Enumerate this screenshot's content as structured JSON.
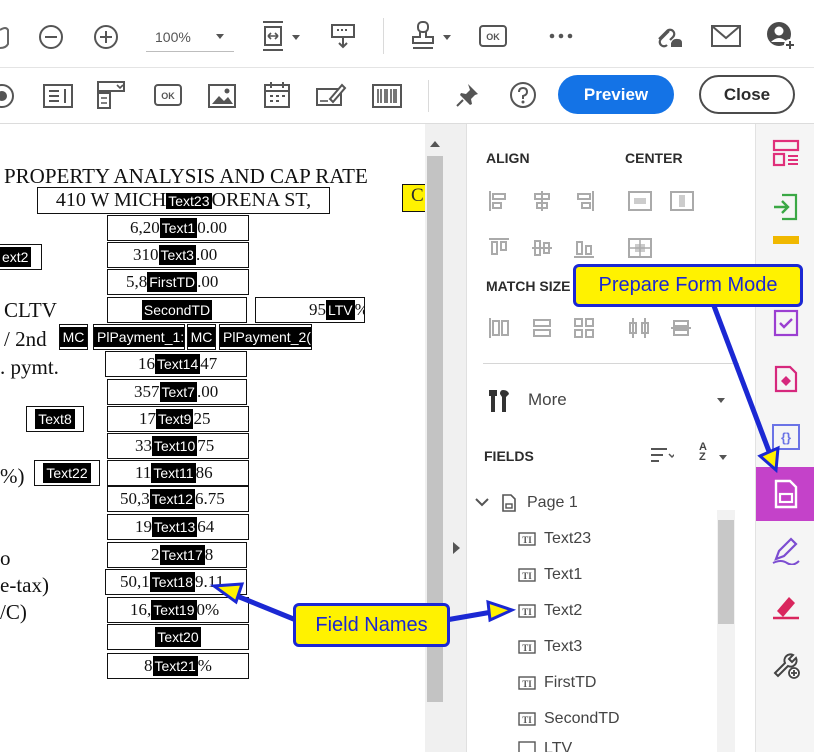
{
  "toolbar": {
    "zoom_value": "100%",
    "preview_label": "Preview",
    "close_label": "Close",
    "ok_label": "OK"
  },
  "document": {
    "title_line": "PROPERTY ANALYSIS AND CAP RATE",
    "address_left": "410 W MICH",
    "address_right": "ORENA ST,",
    "address_field": "Text23",
    "yellow_cell": "C",
    "labels": {
      "cltv": "CLTV",
      "second": "/ 2nd",
      "pymt": ". pymt.",
      "pct": "%)",
      "o": "o",
      "tax": "e-tax)",
      "c": "/C)"
    },
    "side_fields": {
      "text2": "ext2",
      "text8": "Text8",
      "text22": "Text22",
      "mc1": "MC",
      "mc2": "MC",
      "plpayment1": "PlPayment_1:",
      "plpayment2": "PlPayment_2("
    },
    "fields": [
      {
        "left_val": "6,20",
        "name": "Text1",
        "right_val": "0.00"
      },
      {
        "left_val": "310",
        "name": "Text3",
        "right_val": ".00"
      },
      {
        "left_val": "5,8",
        "name": "FirstTD",
        "right_val": ".00"
      },
      {
        "left_val": "",
        "name": "SecondTD",
        "right_val": ""
      },
      {
        "left_val": "16",
        "name": "Text14",
        "right_val": "47"
      },
      {
        "left_val": "357",
        "name": "Text7",
        "right_val": ".00"
      },
      {
        "left_val": "17",
        "name": "Text9",
        "right_val": "25"
      },
      {
        "left_val": "33",
        "name": "Text10",
        "right_val": "75"
      },
      {
        "left_val": "11",
        "name": "Text11",
        "right_val": "86"
      },
      {
        "left_val": "50,3",
        "name": "Text12",
        "right_val": "6.75"
      },
      {
        "left_val": "19",
        "name": "Text13",
        "right_val": "64"
      },
      {
        "left_val": "2",
        "name": "Text17",
        "right_val": "8"
      },
      {
        "left_val": "50,1",
        "name": "Text18",
        "right_val": "9.11"
      },
      {
        "left_val": "16,",
        "name": "Text19",
        "right_val": "0%"
      },
      {
        "left_val": "",
        "name": "Text20",
        "right_val": ""
      },
      {
        "left_val": "8",
        "name": "Text21",
        "right_val": "%"
      }
    ],
    "ltv_field": {
      "left_val": "95",
      "name": "LTV",
      "right_val": "%"
    }
  },
  "pane": {
    "align_title": "ALIGN",
    "center_title": "CENTER",
    "match_size_title": "MATCH SIZE",
    "more_label": "More",
    "fields_title": "FIELDS",
    "sort_glyph": "A Z",
    "page_label": "Page 1",
    "field_items": [
      "Text23",
      "Text1",
      "Text2",
      "Text3",
      "FirstTD",
      "SecondTD",
      "LTV"
    ]
  },
  "callouts": {
    "prepare_form": "Prepare Form Mode",
    "field_names": "Field Names"
  },
  "colors": {
    "accent_blue": "#1473e6",
    "callout_yellow": "#fff200",
    "callout_blue": "#1b28d3",
    "active_rail": "#c442c9"
  }
}
